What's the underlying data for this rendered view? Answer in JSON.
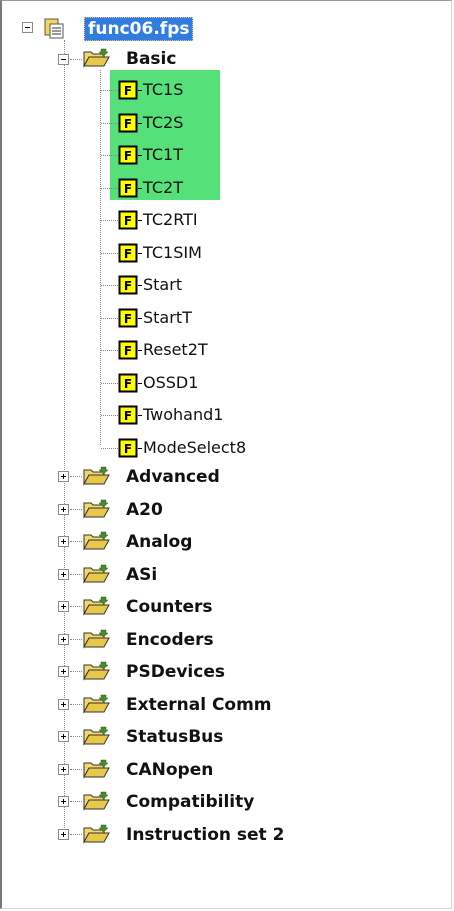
{
  "tree": {
    "root": {
      "label": "func06.fps",
      "icon": "project-icon",
      "selected": true
    },
    "basic": {
      "label": "Basic",
      "expanded": true,
      "items": [
        {
          "label": "TC1S",
          "icon": "function-block-icon",
          "highlight_color": "#55e079"
        },
        {
          "label": "TC2S",
          "icon": "function-block-icon",
          "highlight_color": "#55e079"
        },
        {
          "label": "TC1T",
          "icon": "function-block-icon",
          "highlight_color": "#55e079"
        },
        {
          "label": "TC2T",
          "icon": "function-block-icon",
          "highlight_color": "#55e079"
        },
        {
          "label": "TC2RTI",
          "icon": "function-block-icon"
        },
        {
          "label": "TC1SIM",
          "icon": "function-block-icon"
        },
        {
          "label": "Start",
          "icon": "function-block-icon"
        },
        {
          "label": "StartT",
          "icon": "function-block-icon"
        },
        {
          "label": "Reset2T",
          "icon": "function-block-icon"
        },
        {
          "label": "OSSD1",
          "icon": "function-block-icon"
        },
        {
          "label": "Twohand1",
          "icon": "function-block-icon"
        },
        {
          "label": "ModeSelect8",
          "icon": "function-block-icon"
        }
      ]
    },
    "folders": [
      {
        "label": "Advanced"
      },
      {
        "label": "A20"
      },
      {
        "label": "Analog"
      },
      {
        "label": "ASi"
      },
      {
        "label": "Counters"
      },
      {
        "label": "Encoders"
      },
      {
        "label": "PSDevices"
      },
      {
        "label": "External Comm"
      },
      {
        "label": "StatusBus"
      },
      {
        "label": "CANopen"
      },
      {
        "label": "Compatibility"
      },
      {
        "label": "Instruction set 2"
      }
    ]
  },
  "colors": {
    "selection": "#2f7de1",
    "highlight": "#55e079",
    "fb_fill": "#ffff00",
    "folder": "#e8c84a"
  }
}
